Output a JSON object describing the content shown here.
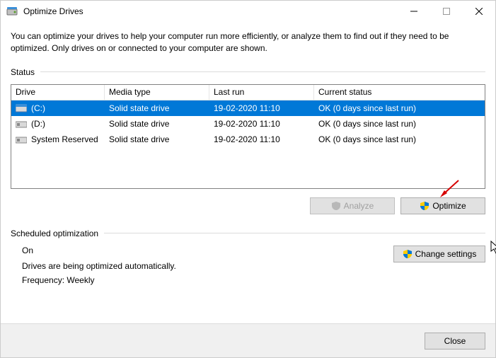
{
  "window": {
    "title": "Optimize Drives",
    "intro": "You can optimize your drives to help your computer run more efficiently, or analyze them to find out if they need to be optimized. Only drives on or connected to your computer are shown."
  },
  "status": {
    "label": "Status",
    "columns": {
      "drive": "Drive",
      "media": "Media type",
      "last": "Last run",
      "status": "Current status"
    },
    "rows": [
      {
        "drive": "(C:)",
        "media": "Solid state drive",
        "last": "19-02-2020 11:10",
        "status": "OK (0 days since last run)",
        "selected": true
      },
      {
        "drive": "(D:)",
        "media": "Solid state drive",
        "last": "19-02-2020 11:10",
        "status": "OK (0 days since last run)",
        "selected": false
      },
      {
        "drive": "System Reserved",
        "media": "Solid state drive",
        "last": "19-02-2020 11:10",
        "status": "OK (0 days since last run)",
        "selected": false
      }
    ],
    "analyze_label": "Analyze",
    "optimize_label": "Optimize"
  },
  "scheduled": {
    "label": "Scheduled optimization",
    "state": "On",
    "desc": "Drives are being optimized automatically.",
    "freq": "Frequency: Weekly",
    "change_label": "Change settings"
  },
  "footer": {
    "close_label": "Close"
  }
}
